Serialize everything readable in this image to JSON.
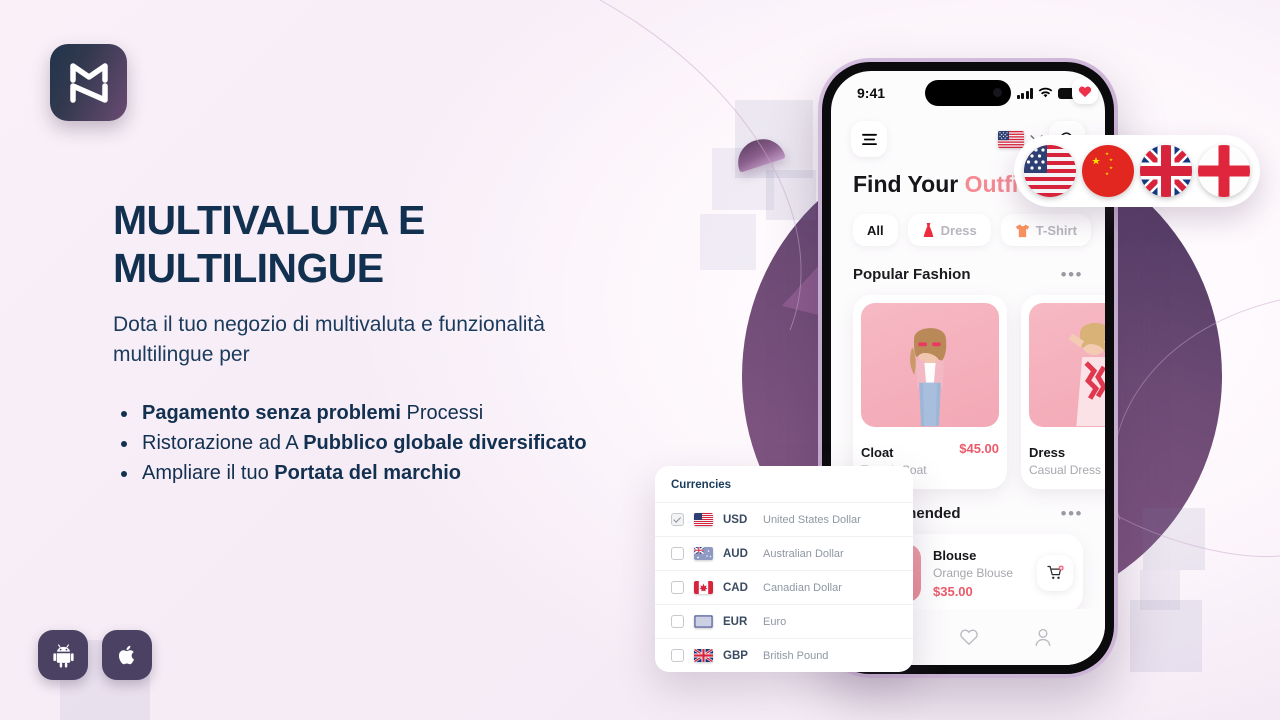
{
  "brand": {
    "logo_name": "MN monogram logo"
  },
  "hero": {
    "headline_line1": "MULTIVALUTA E",
    "headline_line2": "MULTILINGUE",
    "subhead": "Dota il tuo negozio di multivaluta e funzionalità multilingue per",
    "bullets": [
      {
        "bold": "Pagamento senza problemi",
        "rest": " Processi",
        "bold_first": true
      },
      {
        "lead": "Ristorazione ad A ",
        "bold": "Pubblico globale diversificato",
        "bold_first": false
      },
      {
        "lead": "Ampliare il tuo ",
        "bold": "Portata del marchio",
        "bold_first": false
      }
    ]
  },
  "platforms": [
    {
      "name": "android-badge",
      "label": "Android"
    },
    {
      "name": "apple-badge",
      "label": "Apple iOS"
    }
  ],
  "phone": {
    "status": {
      "time": "9:41",
      "signal": "signal-icon",
      "wifi": "wifi-icon",
      "battery": "battery-icon"
    },
    "header": {
      "menu": "hamburger-menu-icon",
      "flag": "US",
      "chevron": "chevron-down-icon",
      "search": "search-icon"
    },
    "title_plain": "Find Your ",
    "title_accent": "Outfit",
    "chips": [
      {
        "label": "All",
        "icon": "",
        "active": true
      },
      {
        "label": "Dress",
        "icon": "dress-icon",
        "active": false
      },
      {
        "label": "T-Shirt",
        "icon": "tshirt-icon",
        "active": false
      }
    ],
    "section1": {
      "title": "Popular Fashion",
      "menu": "•••"
    },
    "cards": [
      {
        "name": "Cloat",
        "desc": "Trench Coat",
        "price": "$45.00",
        "fav": true
      },
      {
        "name": "Dress",
        "desc": "Casual Dress",
        "price": "",
        "fav": false
      }
    ],
    "section2": {
      "title": "Recommended",
      "menu": "•••"
    },
    "list_items": [
      {
        "name": "Blouse",
        "desc": "Orange Blouse",
        "price": "$35.00",
        "action": "add-to-cart-icon"
      }
    ],
    "tabbar": [
      {
        "name": "cart-tab",
        "icon": "cart-icon"
      },
      {
        "name": "favorites-tab",
        "icon": "heart-icon"
      },
      {
        "name": "profile-tab",
        "icon": "person-icon"
      }
    ]
  },
  "flag_pill": [
    {
      "code": "US",
      "label": "United States"
    },
    {
      "code": "CN",
      "label": "China"
    },
    {
      "code": "GB",
      "label": "United Kingdom"
    },
    {
      "code": "EN",
      "label": "England"
    }
  ],
  "currencies": {
    "title": "Currencies",
    "rows": [
      {
        "checked": true,
        "flag": "US",
        "code": "USD",
        "name": "United States Dollar"
      },
      {
        "checked": false,
        "flag": "AU",
        "code": "AUD",
        "name": "Australian Dollar"
      },
      {
        "checked": false,
        "flag": "CA",
        "code": "CAD",
        "name": "Canadian Dollar"
      },
      {
        "checked": false,
        "flag": "EU",
        "code": "EUR",
        "name": "Euro"
      },
      {
        "checked": false,
        "flag": "GB",
        "code": "GBP",
        "name": "British Pound"
      }
    ]
  },
  "colors": {
    "background": "#f8eff7",
    "headline": "#12304f",
    "accent_pink": "#f58a92",
    "price_red": "#ec5a6a",
    "purple_circle": "#7d4f80",
    "badge_purple": "#4b4163"
  }
}
